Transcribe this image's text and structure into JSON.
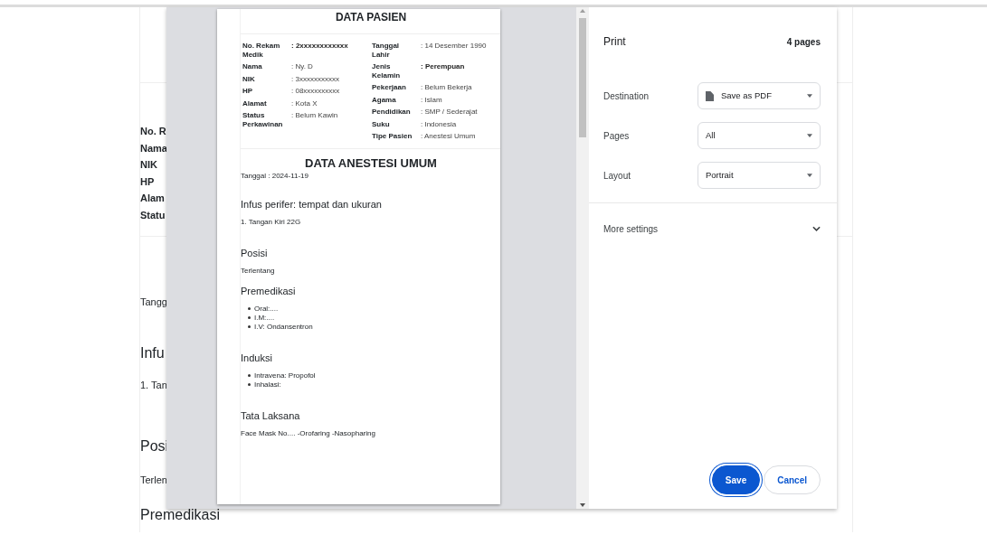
{
  "background_page": {
    "fields": [
      "No. R",
      "Nama",
      "NIK",
      "HP",
      "Alam",
      "Statu"
    ],
    "lines": [
      {
        "kind": "text",
        "text": "Tangg"
      },
      {
        "kind": "heading",
        "text": "Infu"
      },
      {
        "kind": "text",
        "text": "1. Tan"
      },
      {
        "kind": "heading",
        "text": "Posi"
      },
      {
        "kind": "text",
        "text": "Terlen"
      },
      {
        "kind": "heading",
        "text": "Premedikasi"
      }
    ]
  },
  "print_preview": {
    "title": "DATA PASIEN",
    "left_fields": [
      {
        "label": "No. Rekam Medik",
        "value": ": 2xxxxxxxxxxxx",
        "bold": true
      },
      {
        "label": "Nama",
        "value": ": Ny. D",
        "bold": false
      },
      {
        "label": "NIK",
        "value": ": 3xxxxxxxxxxx",
        "bold": false
      },
      {
        "label": "HP",
        "value": ": 08xxxxxxxxxx",
        "bold": false
      },
      {
        "label": "Alamat",
        "value": ": Kota X",
        "bold": false
      },
      {
        "label": "Status Perkawinan",
        "value": ": Belum Kawin",
        "bold": false
      }
    ],
    "right_fields": [
      {
        "label": "Tanggal Lahir",
        "value": ": 14 Desember 1990",
        "bold": false
      },
      {
        "label": "Jenis Kelamin",
        "value": ": Perempuan",
        "bold": true
      },
      {
        "label": "Pekerjaan",
        "value": ": Belum Bekerja",
        "bold": false
      },
      {
        "label": "Agama",
        "value": ": Islam",
        "bold": false
      },
      {
        "label": "Pendidikan",
        "value": ": SMP / Sederajat",
        "bold": false
      },
      {
        "label": "Suku",
        "value": ": Indonesia",
        "bold": false
      },
      {
        "label": "Tipe Pasien",
        "value": ": Anestesi Umum",
        "bold": false
      }
    ],
    "section_title": "DATA ANESTESI UMUM",
    "date": "Tanggal : 2024-11-19",
    "blocks": [
      {
        "kind": "text",
        "heading": "Infus perifer: tempat dan ukuran",
        "items": [
          "1. Tangan Kiri 22G"
        ]
      },
      {
        "kind": "text",
        "heading": "Posisi",
        "items": [
          "Terlentang"
        ]
      },
      {
        "kind": "list",
        "heading": "Premedikasi",
        "items": [
          "Oral:....",
          "I.M:....",
          "I.V: Ondansentron"
        ]
      },
      {
        "kind": "list",
        "heading": "Induksi",
        "items": [
          "Intravena: Propofol",
          "Inhalasi:"
        ]
      },
      {
        "kind": "text",
        "heading": "Tata Laksana",
        "items": [
          "Face Mask No.... -Orofaring -Nasopharing"
        ]
      }
    ]
  },
  "print_settings": {
    "title": "Print",
    "page_count": "4 pages",
    "options": [
      {
        "label": "Destination",
        "value": "Save as PDF",
        "kind": "destination"
      },
      {
        "label": "Pages",
        "value": "All",
        "kind": "plain"
      },
      {
        "label": "Layout",
        "value": "Portrait",
        "kind": "plain"
      }
    ],
    "more_settings": {
      "label": "More settings",
      "expanded": false
    },
    "buttons": [
      {
        "label": "Save",
        "kind": "primary"
      },
      {
        "label": "Cancel",
        "kind": "secondary"
      }
    ]
  }
}
